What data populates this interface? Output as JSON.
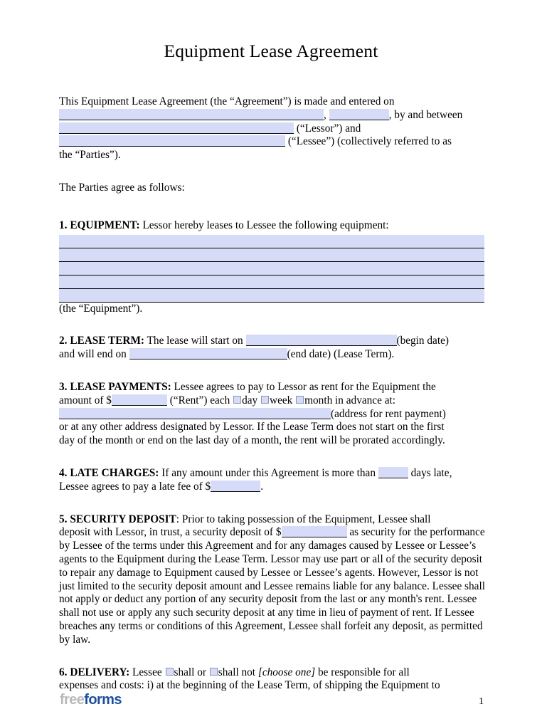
{
  "document": {
    "title": "Equipment Lease Agreement"
  },
  "intro": {
    "line1": "This Equipment Lease Agreement (the “Agreement”) is made and entered on",
    "after_year": ", by and between",
    "comma": ",",
    "lessor_label": "(“Lessor”) and",
    "lessee_label": "(“Lessee”) (collectively referred to as",
    "parties_tail": "the “Parties”).",
    "agree_line": "The Parties agree as follows:"
  },
  "sections": {
    "equipment": {
      "number": "1.",
      "heading": "EQUIPMENT:",
      "text": "Lessor hereby leases to Lessee the following equipment:",
      "blank_lines": 5,
      "closing": "(the “Equipment”)."
    },
    "lease_term": {
      "number": "2.",
      "heading": "LEASE TERM:",
      "text_start": "The lease will start on",
      "begin_label": "(begin date)",
      "text_end": "and will end on",
      "end_label": "(end date) (Lease Term)."
    },
    "lease_payments": {
      "number": "3.",
      "heading": "LEASE PAYMENTS:",
      "text1": "Lessee agrees to pay to Lessor as rent for the Equipment the",
      "text2": "amount of $",
      "rent_label": "(“Rent”) each",
      "option_day": "day",
      "option_week": "week",
      "option_month": "month",
      "text3": "in advance at:",
      "address_label": "(address for rent payment)",
      "text4": "or at any other address designated by Lessor. If the Lease Term does not start on the first",
      "text5": "day of the month or end on the last day of a month, the rent will be prorated accordingly."
    },
    "late_charges": {
      "number": "4.",
      "heading": "LATE CHARGES:",
      "text1": "If any amount under this Agreement is more than",
      "days_label": "days late,",
      "text2": "Lessee agrees to pay a late fee of $",
      "period": "."
    },
    "security_deposit": {
      "number": "5.",
      "heading": "SECURITY DEPOSIT",
      "colon": ":",
      "text1": "Prior to taking possession of the Equipment, Lessee shall",
      "text2": "deposit with Lessor, in trust, a security deposit of $",
      "text3": "as security for the",
      "body": "performance by Lessee of the terms under this Agreement and for any damages caused by Lessee or Lessee’s agents to the Equipment during the Lease Term.  Lessor may use part or all of the security deposit to repair any damage to Equipment caused by Lessee or Lessee’s agents. However, Lessor is not just limited to the security deposit amount and Lessee remains liable for any balance. Lessee shall not apply or deduct any portion of any security deposit from the last or any month's rent. Lessee shall not use or apply any such security deposit at any time in lieu of payment of rent. If Lessee breaches any terms or conditions of this Agreement, Lessee shall forfeit any deposit, as permitted by law."
    },
    "delivery": {
      "number": "6.",
      "heading": "DELIVERY:",
      "text1": "Lessee",
      "option_shall": "shall or",
      "option_shall_not": "shall not",
      "choose_one": "[choose one]",
      "text2": "be responsible for all",
      "text3": "expenses and costs: i) at the beginning of the Lease Term, of shipping the Equipment to"
    }
  },
  "footer": {
    "logo_part1": "free",
    "logo_part2": "forms",
    "page_number": "1"
  }
}
